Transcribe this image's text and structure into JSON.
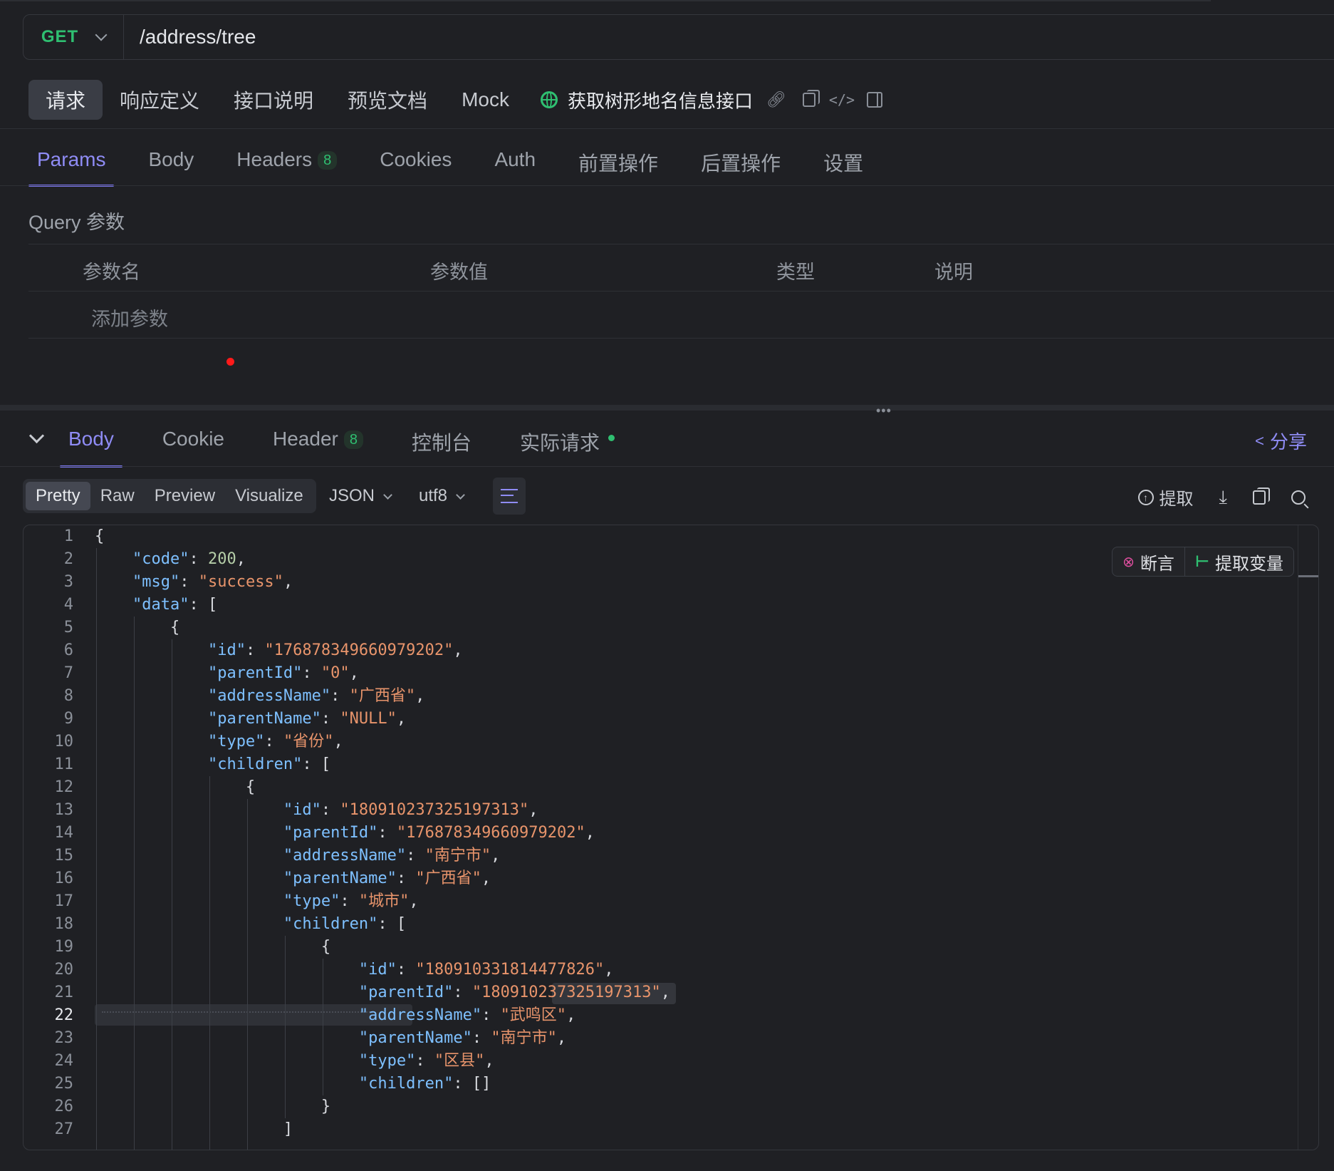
{
  "request": {
    "method": "GET",
    "url": "/address/tree"
  },
  "request_tabs": [
    "请求",
    "响应定义",
    "接口说明",
    "预览文档",
    "Mock"
  ],
  "api_title": "获取树形地名信息接口",
  "param_tabs": {
    "params": "Params",
    "body": "Body",
    "headers": "Headers",
    "headers_count": "8",
    "cookies": "Cookies",
    "auth": "Auth",
    "pre": "前置操作",
    "post": "后置操作",
    "settings": "设置"
  },
  "query": {
    "label": "Query 参数",
    "columns": [
      "参数名",
      "参数值",
      "类型",
      "说明"
    ],
    "add_placeholder": "添加参数"
  },
  "response_tabs": {
    "body": "Body",
    "cookie": "Cookie",
    "header": "Header",
    "header_count": "8",
    "console": "控制台",
    "actual": "实际请求",
    "share": "分享"
  },
  "viewer": {
    "modes": [
      "Pretty",
      "Raw",
      "Preview",
      "Visualize"
    ],
    "format": "JSON",
    "encoding": "utf8",
    "extract": "提取",
    "assert": "断言",
    "extract_var": "提取变量"
  },
  "colors": {
    "accent": "#8f8cf5",
    "method": "#2fbf71",
    "json_key": "#7ec0ff",
    "json_string": "#e8946b",
    "json_number": "#b5cea8"
  },
  "icons": [
    "globe-icon",
    "link-icon",
    "copy-icon",
    "code-icon",
    "panel-icon",
    "share-icon",
    "upload-icon",
    "download-icon",
    "search-icon",
    "assert-icon",
    "variable-icon"
  ],
  "code_lines": [
    {
      "n": "1",
      "i": 0,
      "t": [
        [
          "p",
          "{"
        ]
      ]
    },
    {
      "n": "2",
      "i": 1,
      "t": [
        [
          "k",
          "\"code\""
        ],
        [
          "p",
          ": "
        ],
        [
          "n",
          "200"
        ],
        [
          "p",
          ","
        ]
      ]
    },
    {
      "n": "3",
      "i": 1,
      "t": [
        [
          "k",
          "\"msg\""
        ],
        [
          "p",
          ": "
        ],
        [
          "s",
          "\"success\""
        ],
        [
          "p",
          ","
        ]
      ]
    },
    {
      "n": "4",
      "i": 1,
      "t": [
        [
          "k",
          "\"data\""
        ],
        [
          "p",
          ": ["
        ]
      ]
    },
    {
      "n": "5",
      "i": 2,
      "t": [
        [
          "p",
          "{"
        ]
      ]
    },
    {
      "n": "6",
      "i": 3,
      "t": [
        [
          "k",
          "\"id\""
        ],
        [
          "p",
          ": "
        ],
        [
          "s",
          "\"176878349660979202\""
        ],
        [
          "p",
          ","
        ]
      ]
    },
    {
      "n": "7",
      "i": 3,
      "t": [
        [
          "k",
          "\"parentId\""
        ],
        [
          "p",
          ": "
        ],
        [
          "s",
          "\"0\""
        ],
        [
          "p",
          ","
        ]
      ]
    },
    {
      "n": "8",
      "i": 3,
      "t": [
        [
          "k",
          "\"addressName\""
        ],
        [
          "p",
          ": "
        ],
        [
          "s",
          "\"广西省\""
        ],
        [
          "p",
          ","
        ]
      ]
    },
    {
      "n": "9",
      "i": 3,
      "t": [
        [
          "k",
          "\"parentName\""
        ],
        [
          "p",
          ": "
        ],
        [
          "s",
          "\"NULL\""
        ],
        [
          "p",
          ","
        ]
      ]
    },
    {
      "n": "10",
      "i": 3,
      "t": [
        [
          "k",
          "\"type\""
        ],
        [
          "p",
          ": "
        ],
        [
          "s",
          "\"省份\""
        ],
        [
          "p",
          ","
        ]
      ]
    },
    {
      "n": "11",
      "i": 3,
      "t": [
        [
          "k",
          "\"children\""
        ],
        [
          "p",
          ": ["
        ]
      ]
    },
    {
      "n": "12",
      "i": 4,
      "t": [
        [
          "p",
          "{"
        ]
      ]
    },
    {
      "n": "13",
      "i": 5,
      "t": [
        [
          "k",
          "\"id\""
        ],
        [
          "p",
          ": "
        ],
        [
          "s",
          "\"180910237325197313\""
        ],
        [
          "p",
          ","
        ]
      ]
    },
    {
      "n": "14",
      "i": 5,
      "t": [
        [
          "k",
          "\"parentId\""
        ],
        [
          "p",
          ": "
        ],
        [
          "s",
          "\"176878349660979202\""
        ],
        [
          "p",
          ","
        ]
      ]
    },
    {
      "n": "15",
      "i": 5,
      "t": [
        [
          "k",
          "\"addressName\""
        ],
        [
          "p",
          ": "
        ],
        [
          "s",
          "\"南宁市\""
        ],
        [
          "p",
          ","
        ]
      ]
    },
    {
      "n": "16",
      "i": 5,
      "t": [
        [
          "k",
          "\"parentName\""
        ],
        [
          "p",
          ": "
        ],
        [
          "s",
          "\"广西省\""
        ],
        [
          "p",
          ","
        ]
      ]
    },
    {
      "n": "17",
      "i": 5,
      "t": [
        [
          "k",
          "\"type\""
        ],
        [
          "p",
          ": "
        ],
        [
          "s",
          "\"城市\""
        ],
        [
          "p",
          ","
        ]
      ]
    },
    {
      "n": "18",
      "i": 5,
      "t": [
        [
          "k",
          "\"children\""
        ],
        [
          "p",
          ": ["
        ]
      ]
    },
    {
      "n": "19",
      "i": 6,
      "t": [
        [
          "p",
          "{"
        ]
      ]
    },
    {
      "n": "20",
      "i": 7,
      "t": [
        [
          "k",
          "\"id\""
        ],
        [
          "p",
          ": "
        ],
        [
          "s",
          "\"180910331814477826\""
        ],
        [
          "p",
          ","
        ]
      ]
    },
    {
      "n": "21",
      "i": 7,
      "t": [
        [
          "k",
          "\"parentId\""
        ],
        [
          "p",
          ": "
        ],
        [
          "s",
          "\"180910237325197313\""
        ],
        [
          "p",
          ","
        ]
      ]
    },
    {
      "n": "22",
      "i": 7,
      "t": [
        [
          "k",
          "\"addressName\""
        ],
        [
          "p",
          ": "
        ],
        [
          "s",
          "\"武鸣区\""
        ],
        [
          "p",
          ","
        ]
      ]
    },
    {
      "n": "23",
      "i": 7,
      "t": [
        [
          "k",
          "\"parentName\""
        ],
        [
          "p",
          ": "
        ],
        [
          "s",
          "\"南宁市\""
        ],
        [
          "p",
          ","
        ]
      ]
    },
    {
      "n": "24",
      "i": 7,
      "t": [
        [
          "k",
          "\"type\""
        ],
        [
          "p",
          ": "
        ],
        [
          "s",
          "\"区县\""
        ],
        [
          "p",
          ","
        ]
      ]
    },
    {
      "n": "25",
      "i": 7,
      "t": [
        [
          "k",
          "\"children\""
        ],
        [
          "p",
          ": []"
        ]
      ]
    },
    {
      "n": "26",
      "i": 6,
      "t": [
        [
          "p",
          "}"
        ]
      ]
    },
    {
      "n": "27",
      "i": 5,
      "t": [
        [
          "p",
          "]"
        ]
      ]
    }
  ],
  "current_line": "22"
}
